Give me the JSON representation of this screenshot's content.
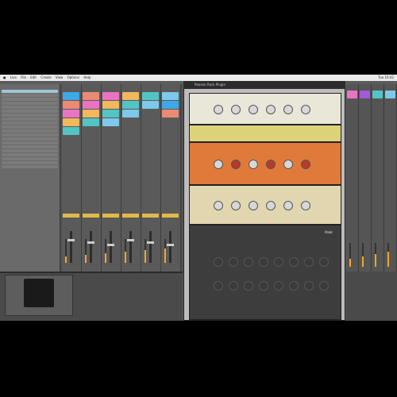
{
  "menubar": {
    "app_items": [
      "Live",
      "File",
      "Edit",
      "Create",
      "View",
      "Options",
      "Help"
    ],
    "status": "Tue 10:42"
  },
  "rack": {
    "title": "Reason Rack Plugin",
    "units": [
      {
        "name": "combinator",
        "color": "#e9e7d8"
      },
      {
        "name": "mixer-strip",
        "color": "#dcd27a"
      },
      {
        "name": "echo",
        "color": "#e07a3a"
      },
      {
        "name": "channel-eq",
        "color": "#e2d6b0"
      },
      {
        "name": "synth",
        "color": "#3d3d3d"
      }
    ],
    "brand_label": "Polar"
  },
  "tracks": {
    "clip_colors": [
      "#3da9e8",
      "#e98b73",
      "#ea73c4",
      "#f1b85e",
      "#53c4c4",
      "#7ec8ea"
    ]
  },
  "colors": {
    "accent": "#f5a623",
    "background": "#5b5b5b"
  }
}
